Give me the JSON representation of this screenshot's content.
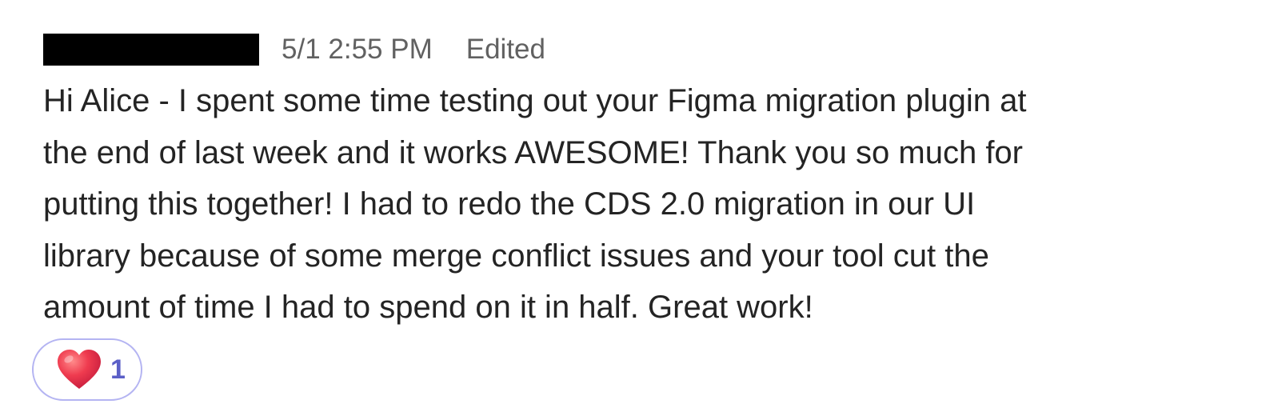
{
  "message": {
    "timestamp": "5/1 2:55 PM",
    "edited_label": "Edited",
    "body_lines": [
      "Hi Alice - I spent some time testing out your Figma migration plugin at",
      "the end of last week and it works AWESOME! Thank you so much for",
      "putting this together! I had to redo the CDS 2.0 migration in our UI",
      "library because of some merge conflict issues and your tool cut the",
      "amount of time I had to spend on it in half. Great work!"
    ],
    "reaction": {
      "icon": "heart-icon",
      "count": "1"
    }
  },
  "colors": {
    "meta_text": "#616161",
    "body_text": "#242424",
    "reaction_border": "#b4b4f2",
    "reaction_count": "#5b5fc7",
    "heart": "#e8344e"
  }
}
